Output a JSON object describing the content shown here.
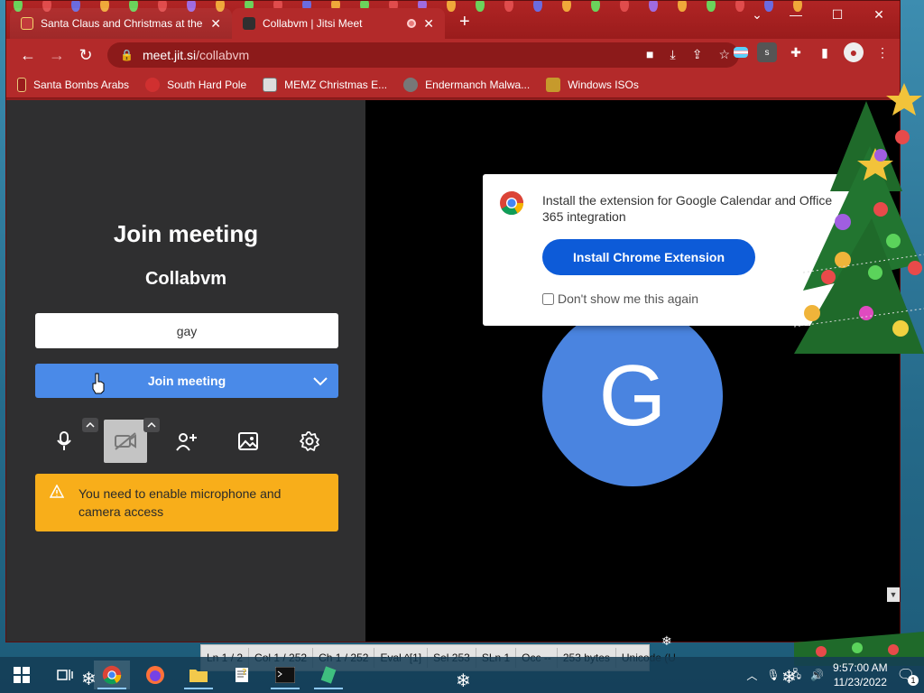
{
  "browser": {
    "tabs": [
      {
        "title": "Santa Claus and Christmas at the",
        "active": false
      },
      {
        "title": "Collabvm | Jitsi Meet",
        "active": true
      }
    ],
    "url_host": "meet.jit.si",
    "url_path": "/collabvm",
    "bookmarks": [
      {
        "label": "Santa Bombs Arabs",
        "icon": "santa-icon"
      },
      {
        "label": "South Hard Pole",
        "icon": "pole-icon"
      },
      {
        "label": "MEMZ Christmas E...",
        "icon": "memz-icon"
      },
      {
        "label": "Endermanch Malwa...",
        "icon": "enderman-icon"
      },
      {
        "label": "Windows ISOs",
        "icon": "folder-icon"
      }
    ]
  },
  "join": {
    "title": "Join meeting",
    "room": "Collabvm",
    "name_value": "gay",
    "button": "Join meeting",
    "warning": "You need to enable microphone and camera access"
  },
  "popup": {
    "text": "Install the extension for Google Calendar and Office 365 integration",
    "button": "Install Chrome Extension",
    "checkbox": "Don't show me this again"
  },
  "avatar": {
    "initial": "G",
    "color": "#4a84e0"
  },
  "statusbar": [
    "Ln  1 / 2",
    "Col  1 / 252",
    "Ch  1 / 252",
    "Eval  ^[1]",
    "Sel  253",
    "SLn  1",
    "Occ  --",
    "253 bytes",
    "Unicode (U"
  ],
  "clock": {
    "time": "9:57:00 AM",
    "date": "11/23/2022"
  },
  "notifications": "1",
  "colors": {
    "accent": "#4a8ae8",
    "warning": "#f8ae1a",
    "browser_theme": "#b32a2a"
  }
}
